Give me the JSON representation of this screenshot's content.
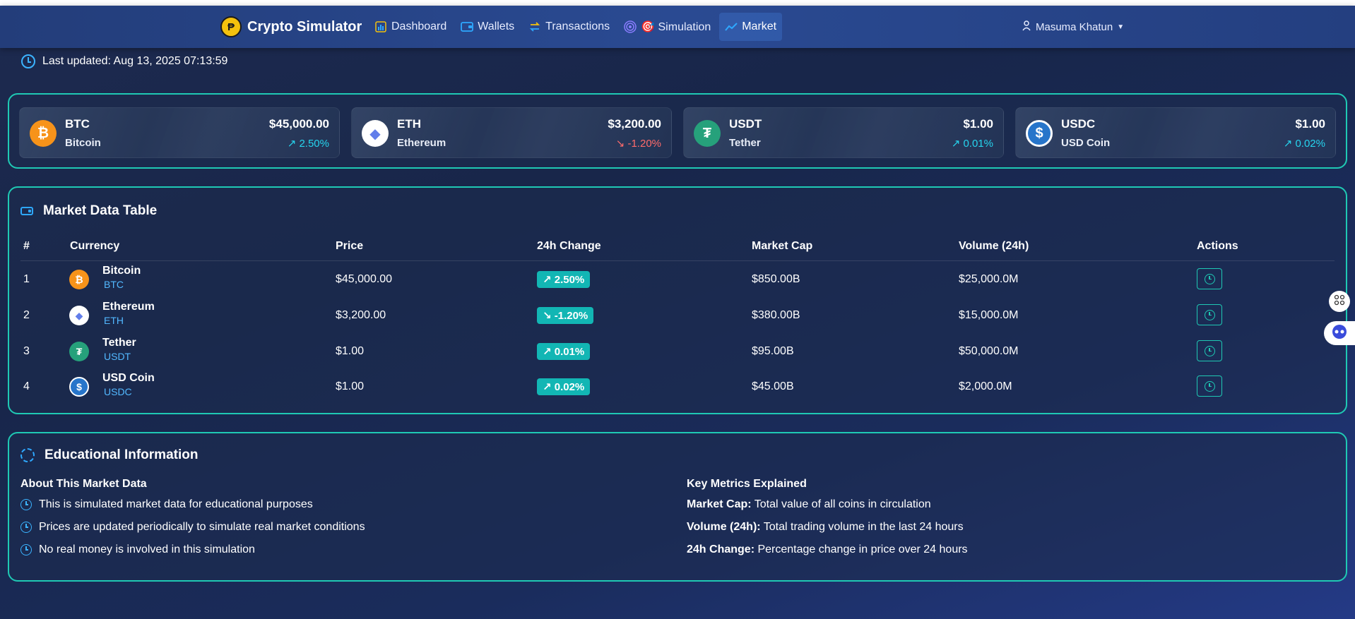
{
  "app": {
    "title": "Crypto Simulator",
    "logo_glyph": "₱"
  },
  "nav": {
    "items": [
      {
        "label": "Dashboard",
        "icon": "bar-chart-icon"
      },
      {
        "label": "Wallets",
        "icon": "wallet-icon"
      },
      {
        "label": "Transactions",
        "icon": "exchange-icon"
      },
      {
        "label": "🎯 Simulation",
        "icon": "target-icon"
      },
      {
        "label": "Market",
        "icon": "trend-icon",
        "active": true
      }
    ]
  },
  "user": {
    "name": "Masuma Khatun"
  },
  "status": {
    "last_updated": "Last updated: Aug 13, 2025 07:13:59"
  },
  "ticker": [
    {
      "symbol": "BTC",
      "name": "Bitcoin",
      "price": "$45,000.00",
      "change": "↗ 2.50%",
      "direction": "up",
      "color": "#f7931a",
      "glyph": "₿"
    },
    {
      "symbol": "ETH",
      "name": "Ethereum",
      "price": "$3,200.00",
      "change": "↘ -1.20%",
      "direction": "down",
      "color": "#ffffff",
      "glyph": "◆"
    },
    {
      "symbol": "USDT",
      "name": "Tether",
      "price": "$1.00",
      "change": "↗ 0.01%",
      "direction": "up",
      "color": "#26a17b",
      "glyph": "₮"
    },
    {
      "symbol": "USDC",
      "name": "USD Coin",
      "price": "$1.00",
      "change": "↗ 0.02%",
      "direction": "up",
      "color": "#2775ca",
      "glyph": "$"
    }
  ],
  "market_table": {
    "title": "Market Data Table",
    "headers": [
      "#",
      "Currency",
      "Price",
      "24h Change",
      "Market Cap",
      "Volume (24h)",
      "Actions"
    ],
    "rows": [
      {
        "num": "1",
        "name": "Bitcoin",
        "symbol": "BTC",
        "price": "$45,000.00",
        "change": "↗ 2.50%",
        "cap": "$850.00B",
        "volume": "$25,000.0M"
      },
      {
        "num": "2",
        "name": "Ethereum",
        "symbol": "ETH",
        "price": "$3,200.00",
        "change": "↘ -1.20%",
        "cap": "$380.00B",
        "volume": "$15,000.0M"
      },
      {
        "num": "3",
        "name": "Tether",
        "symbol": "USDT",
        "price": "$1.00",
        "change": "↗ 0.01%",
        "cap": "$95.00B",
        "volume": "$50,000.0M"
      },
      {
        "num": "4",
        "name": "USD Coin",
        "symbol": "USDC",
        "price": "$1.00",
        "change": "↗ 0.02%",
        "cap": "$45.00B",
        "volume": "$2,000.0M"
      }
    ]
  },
  "education": {
    "title": "Educational Information",
    "about_title": "About This Market Data",
    "about_items": [
      "This is simulated market data for educational purposes",
      "Prices are updated periodically to simulate real market conditions",
      "No real money is involved in this simulation"
    ],
    "metrics_title": "Key Metrics Explained",
    "metrics": [
      {
        "term": "Market Cap:",
        "desc": " Total value of all coins in circulation"
      },
      {
        "term": "Volume (24h):",
        "desc": " Total trading volume in the last 24 hours"
      },
      {
        "term": "24h Change:",
        "desc": " Percentage change in price over 24 hours"
      }
    ]
  },
  "colors": {
    "accent": "#1fc9b4",
    "up": "#26d4ee",
    "down": "#ff6b6b",
    "badge": "#12b6b4"
  }
}
